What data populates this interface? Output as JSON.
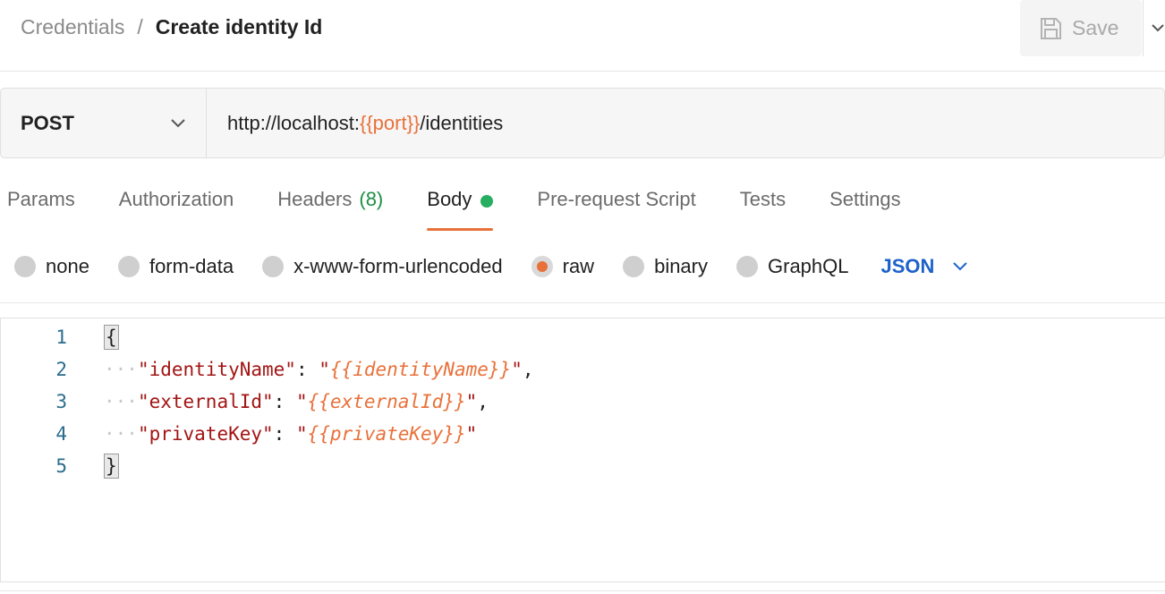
{
  "breadcrumb": {
    "parent": "Credentials",
    "separator": "/",
    "current": "Create identity Id"
  },
  "save": {
    "label": "Save",
    "icon": "save-icon"
  },
  "request": {
    "method": "POST",
    "url_prefix": "http://localhost:",
    "url_variable": "{{port}}",
    "url_suffix": "/identities"
  },
  "tabs": [
    {
      "label": "Params"
    },
    {
      "label": "Authorization"
    },
    {
      "label": "Headers",
      "count": "(8)"
    },
    {
      "label": "Body",
      "active": true
    },
    {
      "label": "Pre-request Script"
    },
    {
      "label": "Tests"
    },
    {
      "label": "Settings"
    }
  ],
  "body_types": {
    "options": [
      "none",
      "form-data",
      "x-www-form-urlencoded",
      "raw",
      "binary",
      "GraphQL"
    ],
    "selected": "raw",
    "format": "JSON"
  },
  "editor": {
    "line_numbers": [
      "1",
      "2",
      "3",
      "4",
      "5"
    ],
    "open_brace": "{",
    "close_brace": "}",
    "indent": "···",
    "entries": [
      {
        "key": "\"identityName\"",
        "value": "{{identityName}}",
        "trailing": ","
      },
      {
        "key": "\"externalId\"",
        "value": "{{externalId}}",
        "trailing": ","
      },
      {
        "key": "\"privateKey\"",
        "value": "{{privateKey}}",
        "trailing": ""
      }
    ]
  },
  "colors": {
    "accent": "#e8713a",
    "link": "#1e62c9",
    "success": "#27ae60",
    "key": "#a31515"
  }
}
